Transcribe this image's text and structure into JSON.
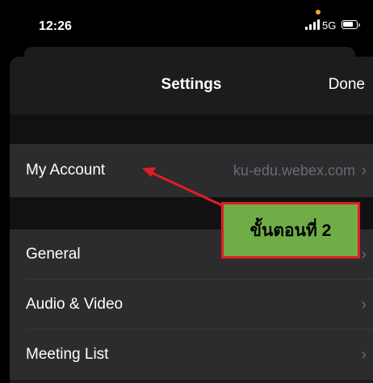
{
  "status_bar": {
    "time": "12:26",
    "network": "5G"
  },
  "nav": {
    "title": "Settings",
    "done_label": "Done"
  },
  "rows": {
    "my_account": {
      "label": "My Account",
      "value": "ku-edu.webex.com"
    },
    "general": {
      "label": "General"
    },
    "audio_video": {
      "label": "Audio & Video"
    },
    "meeting_list": {
      "label": "Meeting List"
    }
  },
  "annotation": {
    "text": "ขั้นตอนที่ 2"
  },
  "colors": {
    "annotation_fill": "#70ad47",
    "annotation_border": "#e31c25",
    "arrow": "#e31c25"
  },
  "icons": [
    "signal-icon",
    "battery-icon",
    "chevron-right-icon"
  ]
}
